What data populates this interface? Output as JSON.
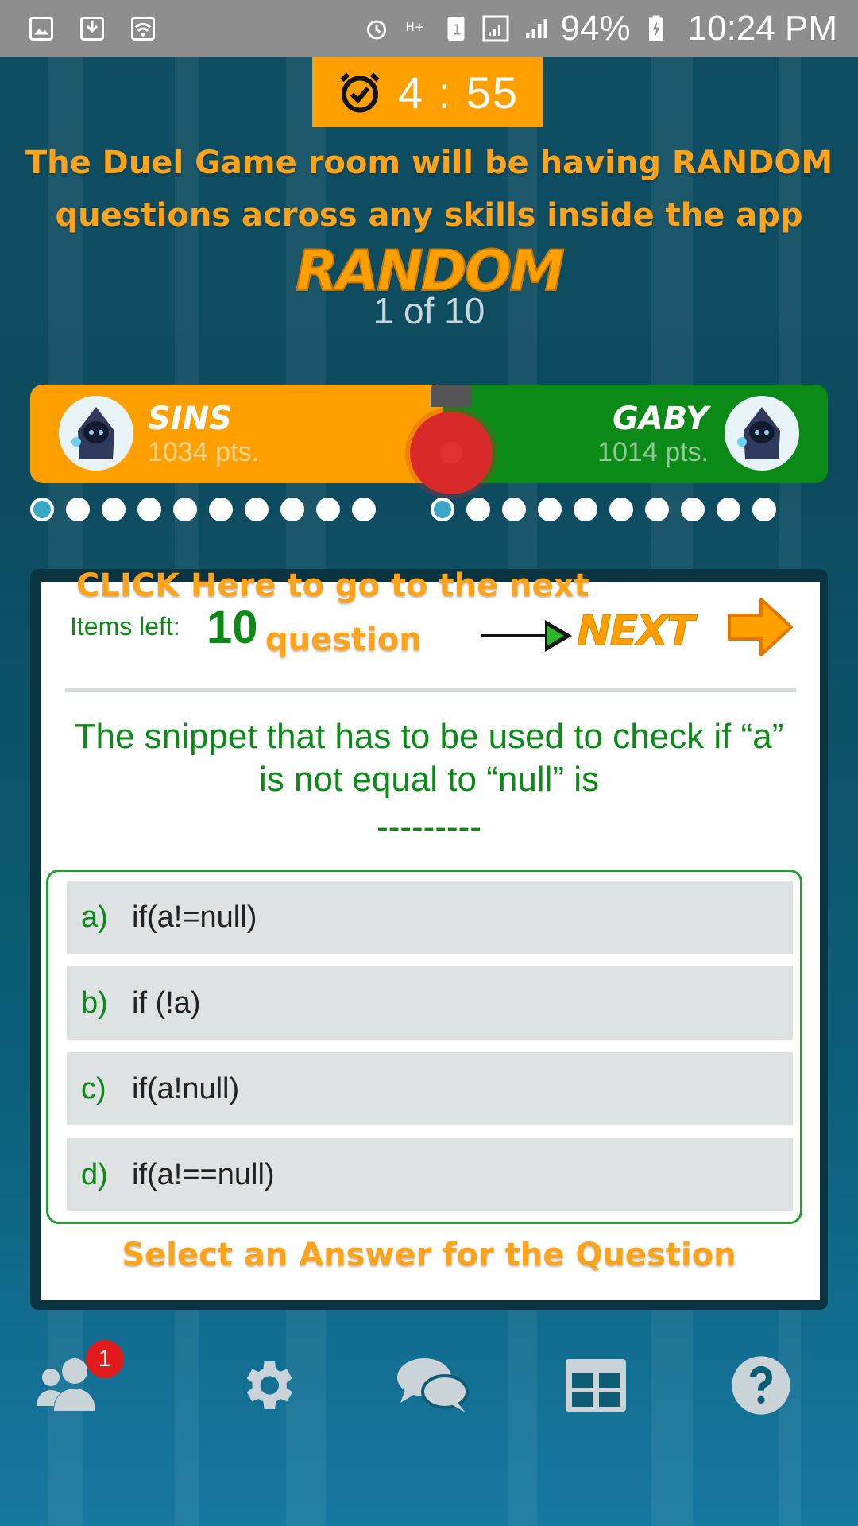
{
  "status_bar": {
    "battery": "94%",
    "time": "10:24 PM",
    "icons": [
      "gallery-icon",
      "download-icon",
      "wifi-icon",
      "alarm-icon",
      "hplus-data-icon",
      "sim1-icon",
      "signal-icon",
      "signal-icon",
      "battery-charging-icon"
    ]
  },
  "timer": {
    "value": "4 : 55",
    "icon": "alarm-clock-icon"
  },
  "intro": {
    "line1": "The Duel Game room will be having RANDOM",
    "line2": "questions across any skills inside the app"
  },
  "category": "RANDOM",
  "question_counter": "1 of 10",
  "players": {
    "left": {
      "name": "SINS",
      "points": "1034 pts."
    },
    "right": {
      "name": "GABY",
      "points": "1014 pts."
    }
  },
  "progress": {
    "left_total": 10,
    "left_current": 1,
    "right_total": 10,
    "right_current": 1
  },
  "card": {
    "click_hint_line1": "CLICK Here to go to the next",
    "click_hint_line2": "question",
    "items_left_label": "Items left:",
    "items_left_count": "10",
    "next_label": "NEXT",
    "question": "The snippet that has to be used to check if “a” is not equal to “null” is",
    "blank": "---------",
    "answers": [
      {
        "letter": "a)",
        "text": "if(a!=null)"
      },
      {
        "letter": "b)",
        "text": "if (!a)"
      },
      {
        "letter": "c)",
        "text": "if(a!null)"
      },
      {
        "letter": "d)",
        "text": "if(a!==null)"
      }
    ],
    "select_hint": "Select an Answer for the Question"
  },
  "bottom_nav": {
    "items": [
      "friends-icon",
      "settings-icon",
      "chat-icon",
      "leaderboard-icon",
      "help-icon"
    ],
    "friends_badge": "1"
  },
  "colors": {
    "orange": "#ffa000",
    "green": "#0c8a17",
    "background": "#0d4a5e"
  }
}
